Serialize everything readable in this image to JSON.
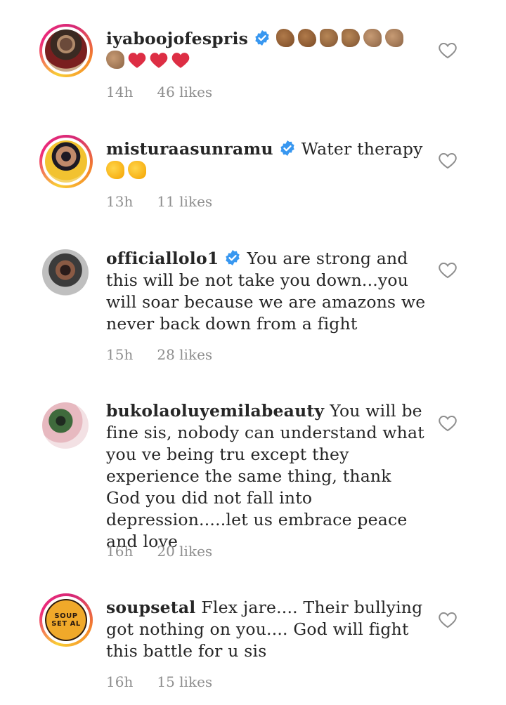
{
  "comments": [
    {
      "username": "iyaboojofespris",
      "verified": true,
      "text": "",
      "emoji": [
        "flexed-biceps",
        "flexed-biceps",
        "left-fist",
        "left-fist",
        "clapping-hands",
        "clapping-hands",
        "clapping-hands",
        "red-heart",
        "red-heart",
        "red-heart"
      ],
      "time": "14h",
      "likes": "46 likes"
    },
    {
      "username": "misturaasunramu",
      "verified": true,
      "text": "Water therapy",
      "emoji": [
        "clapping-hands-yellow",
        "clapping-hands-yellow"
      ],
      "time": "13h",
      "likes": "11 likes"
    },
    {
      "username": "officiallolo1",
      "verified": true,
      "text": "You are strong and this will be not take you down...you will soar because we are amazons we never back down from a fight",
      "time": "15h",
      "likes": "28 likes"
    },
    {
      "username": "bukolaoluyemilabeauty",
      "verified": false,
      "text": "You will be fine sis, nobody can understand what you ve being tru  except they experience the same thing, thank God you did not fall into depression.....let us embrace peace and love",
      "time": "16h",
      "likes": "20 likes"
    },
    {
      "username": "soupsetal",
      "verified": false,
      "text": "Flex jare.... Their bullying got nothing on you.... God will fight this battle for u sis",
      "time": "16h",
      "likes": "15 likes",
      "logo_text": "SOUP SET AL"
    }
  ],
  "colors": {
    "verified": "#3897f0",
    "meta": "#8e8e8e",
    "heart_emoji": "#dd2e44"
  }
}
